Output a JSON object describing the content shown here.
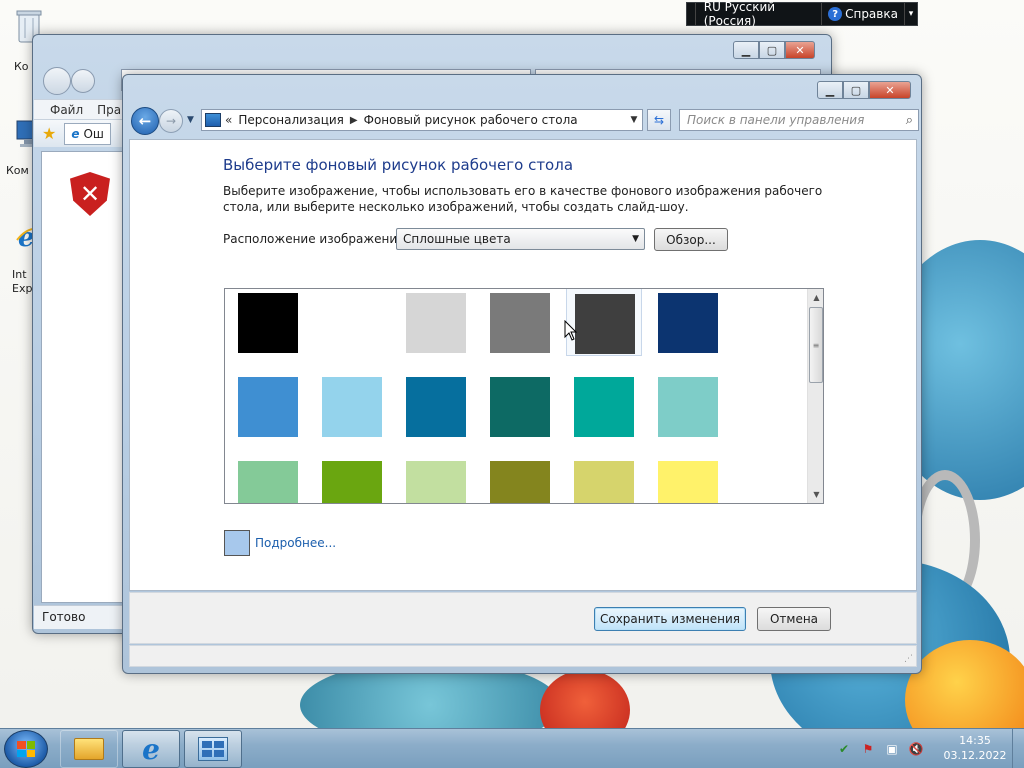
{
  "desktop": {
    "icons": [
      {
        "label": "Ко"
      },
      {
        "label": "Ком"
      },
      {
        "label": "Int\nExp"
      }
    ]
  },
  "langbar": {
    "language": "RU Русский (Россия)",
    "help": "Справка"
  },
  "ie_window": {
    "menu": [
      "Файл",
      "Прав"
    ],
    "tab_label": "Ош",
    "status": "Готово"
  },
  "personalization": {
    "breadcrumb": [
      "Персонализация",
      "Фоновый рисунок рабочего стола"
    ],
    "search_placeholder": "Поиск в панели управления",
    "heading": "Выберите фоновый рисунок рабочего стола",
    "description": "Выберите изображение, чтобы использовать его в качестве фонового изображения рабочего стола, или выберите несколько изображений, чтобы создать слайд-шоу.",
    "location_label": "Расположение изображения:",
    "location_value": "Сплошные цвета",
    "browse_label": "Обзор...",
    "more_label": "Подробнее...",
    "more_color": "#a7c8ec",
    "save_label": "Сохранить изменения",
    "cancel_label": "Отмена",
    "swatches": [
      [
        "#000000",
        "#ffffff",
        "#d6d6d6",
        "#7a7a7a",
        "#3f3f3f",
        "#0c3470"
      ],
      [
        "#3f8fd2",
        "#94d3ec",
        "#066f9e",
        "#0d6a64",
        "#00a89a",
        "#7ecdc8"
      ],
      [
        "#84ca98",
        "#6aa610",
        "#c2dfa0",
        "#84851e",
        "#d6d46c",
        "#fff26a"
      ]
    ],
    "hovered_swatch": [
      0,
      4
    ]
  },
  "taskbar": {
    "time": "14:35",
    "date": "03.12.2022"
  }
}
